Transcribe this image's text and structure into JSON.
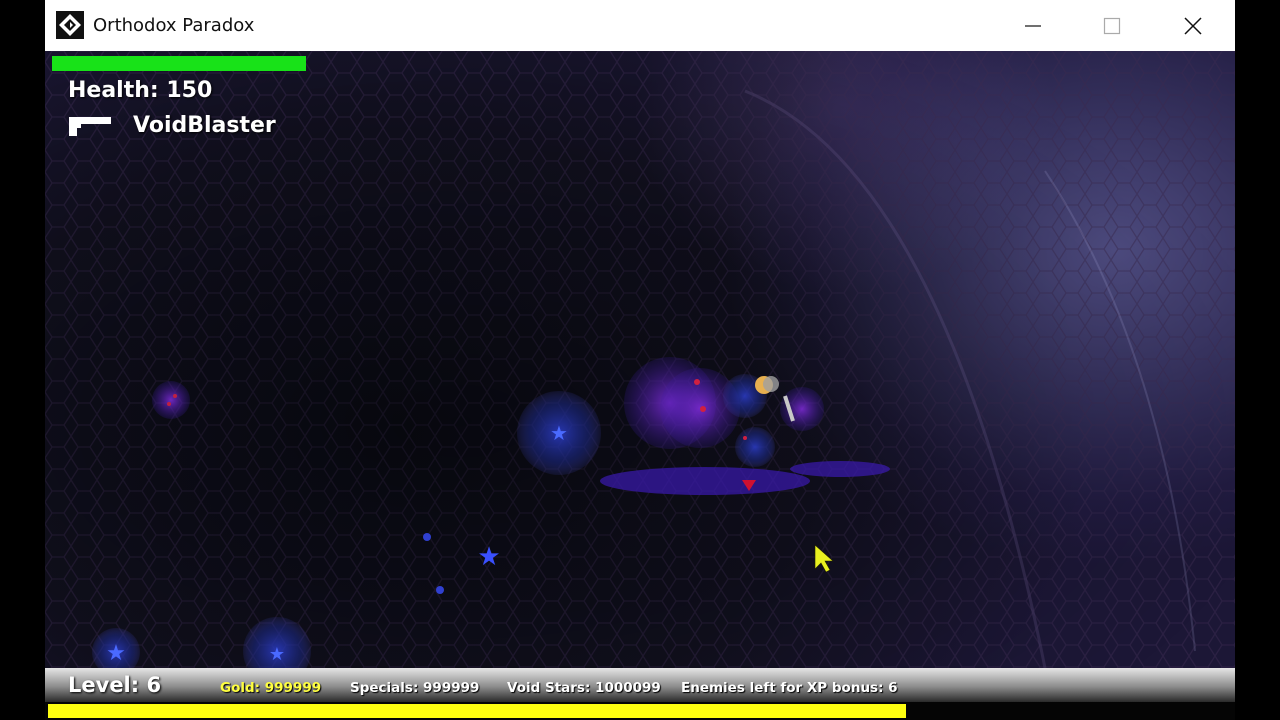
{
  "window": {
    "title": "Orthodox Paradox",
    "controls": [
      "minimize",
      "maximize",
      "close"
    ]
  },
  "hud": {
    "health_label": "Health: 150",
    "health_fraction": 1.0,
    "health_bar_color": "#18e218",
    "weapon_icon": "pistol-icon",
    "weapon_name": "VoidBlaster"
  },
  "status_bar": {
    "level": "Level: 6",
    "gold": "Gold: 999999",
    "specials": "Specials: 999999",
    "void_stars": "Void Stars: 1000099",
    "enemies_left": "Enemies left for XP bonus: 6",
    "gold_color": "#ffff40"
  },
  "xp": {
    "fraction": 0.725,
    "bar_color": "#ffff10"
  },
  "scene": {
    "enemies": [
      "blue-orb",
      "blue-orb",
      "blue-orb",
      "blue-orb",
      "blue-orb",
      "purple-cluster"
    ],
    "player": "player-character",
    "cursor": "yellow-cursor-icon"
  }
}
